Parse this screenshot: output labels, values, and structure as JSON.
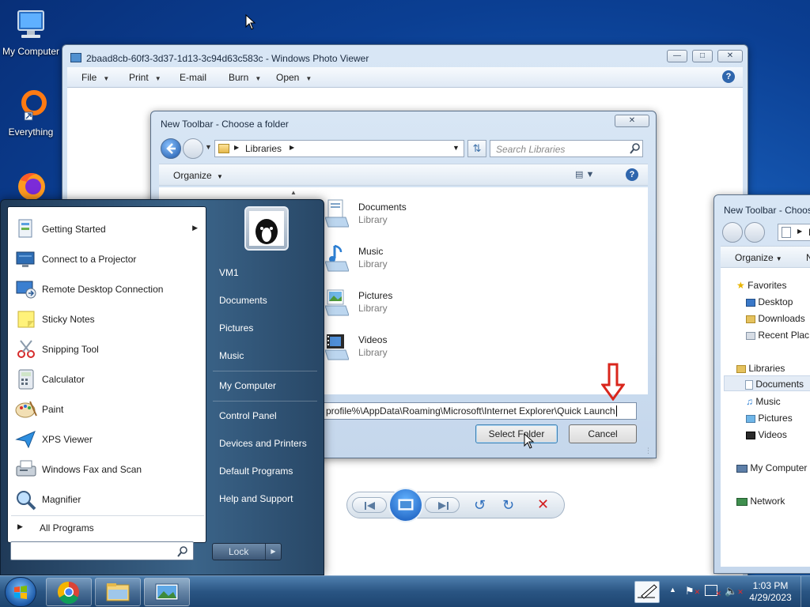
{
  "desktop": {
    "icons": [
      {
        "label": "My Computer"
      },
      {
        "label": "Everything"
      }
    ]
  },
  "photo_viewer": {
    "title": "2baad8cb-60f3-3d37-1d13-3c94d63c583c - Windows Photo Viewer",
    "menu": [
      {
        "label": "File"
      },
      {
        "label": "Print"
      },
      {
        "label": "E-mail"
      },
      {
        "label": "Burn"
      },
      {
        "label": "Open"
      }
    ]
  },
  "folder_dialog": {
    "title": "New Toolbar - Choose a folder",
    "address": "Libraries",
    "search_placeholder": "Search Libraries",
    "organize_label": "Organize",
    "libraries": [
      {
        "name": "Documents",
        "type": "Library"
      },
      {
        "name": "Music",
        "type": "Library"
      },
      {
        "name": "Pictures",
        "type": "Library"
      },
      {
        "name": "Videos",
        "type": "Library"
      }
    ],
    "folder_value": "profile%\\AppData\\Roaming\\Microsoft\\Internet Explorer\\Quick Launch",
    "select_button": "Select Folder",
    "cancel_button": "Cancel"
  },
  "folder_dialog_2": {
    "title": "New Toolbar - Choos",
    "address_fragment": "L",
    "organize_label": "Organize",
    "toolbar_fragment": "N",
    "nav": {
      "favorites": "Favorites",
      "desktop": "Desktop",
      "downloads": "Downloads",
      "recent": "Recent Plac",
      "libraries": "Libraries",
      "documents": "Documents",
      "music": "Music",
      "pictures": "Pictures",
      "videos": "Videos",
      "computer": "My Computer",
      "network": "Network"
    }
  },
  "start_menu": {
    "programs": [
      {
        "label": "Getting Started",
        "has_submenu": true
      },
      {
        "label": "Connect to a Projector"
      },
      {
        "label": "Remote Desktop Connection"
      },
      {
        "label": "Sticky Notes"
      },
      {
        "label": "Snipping Tool"
      },
      {
        "label": "Calculator"
      },
      {
        "label": "Paint"
      },
      {
        "label": "XPS Viewer"
      },
      {
        "label": "Windows Fax and Scan"
      },
      {
        "label": "Magnifier"
      }
    ],
    "all_programs": "All Programs",
    "right": {
      "user": "VM1",
      "documents": "Documents",
      "pictures": "Pictures",
      "music": "Music",
      "computer": "My Computer",
      "control_panel": "Control Panel",
      "devices": "Devices and Printers",
      "default_programs": "Default Programs",
      "help": "Help and Support"
    },
    "lock_label": "Lock"
  },
  "taskbar": {
    "time": "1:03 PM",
    "date": "4/29/2023"
  },
  "colors": {
    "accent_blue": "#1a63c0",
    "annotation_red": "#d9261c"
  }
}
